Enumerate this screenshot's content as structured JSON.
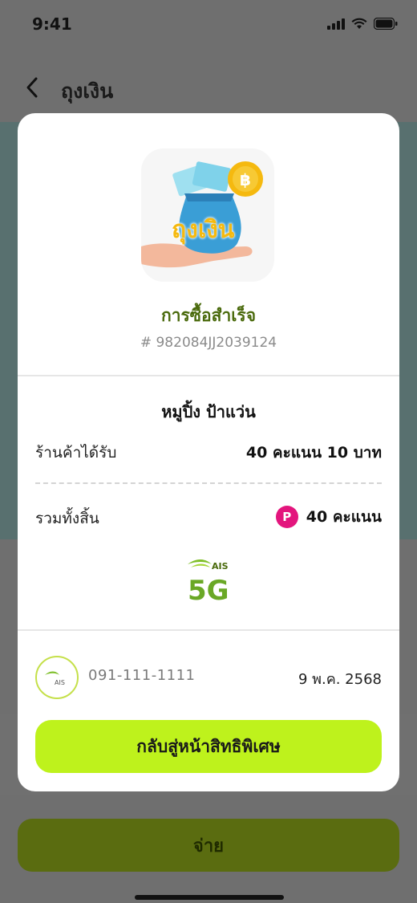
{
  "status_bar": {
    "time": "9:41"
  },
  "header": {
    "title": "ถุงเงิน"
  },
  "card": {
    "app_icon_text": "ถุงเงิน",
    "success_title": "การซื้อสำเร็จ",
    "order_id": "# 982084JJ2039124",
    "shop_name": "หมูปิ้ง ป้าแว่น",
    "received_label": "ร้านค้าได้รับ",
    "received_value": "40 คะแนน 10 บาท",
    "total_label": "รวมทั้งสิ้น",
    "points_badge": "P",
    "total_value": "40 คะแนน",
    "brand_logo_text": "AIS",
    "brand_logo_5g": "5G",
    "avatar_logo_text": "AIS",
    "phone_number": "091-111-1111",
    "date": "9 พ.ค. 2568",
    "back_button_label": "กลับสู่หน้าสิทธิพิเศษ"
  },
  "pay_button_label": "จ่าย",
  "colors": {
    "accent_lime": "#bef21c",
    "success_green": "#4a6a0c",
    "points_pink": "#e3157d",
    "dim_overlay": "#6f6f6f"
  }
}
